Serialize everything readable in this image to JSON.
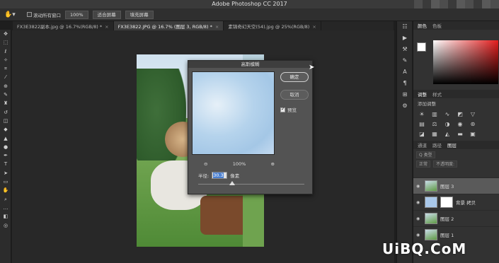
{
  "app": {
    "title": "Adobe Photoshop CC 2017"
  },
  "options": {
    "scroll_all_label": "滚动所有窗口",
    "zoom_100": "100%",
    "fit_screen": "适合屏幕",
    "fill_screen": "填充屏幕"
  },
  "tabs": [
    {
      "label": "FX3E3822副本.jpg @ 16.7%(RGB/8) *"
    },
    {
      "label": "FX3E3822.JPG @ 16.7% (图层 3, RGB/8) *"
    },
    {
      "label": "素锦奇幻天空(54).jpg @ 25%(RGB/8)"
    }
  ],
  "dialog": {
    "title": "高斯模糊",
    "ok_label": "确定",
    "cancel_label": "取消",
    "preview_label": "预览",
    "preview_checked": true,
    "zoom": "100%",
    "radius_label": "半径:",
    "radius_value": "30.3",
    "unit": "像素"
  },
  "panels": {
    "color_tabs": [
      "颜色",
      "色板"
    ],
    "adjust_tabs": [
      "调整",
      "样式"
    ],
    "adjust_add_label": "添加调整",
    "layer_tabs": [
      "通道",
      "路径",
      "图层"
    ],
    "kind_label": "Q 类型",
    "blend_mode": "正常",
    "opacity_label": "不透明度:"
  },
  "layers": [
    {
      "name": "图层 3",
      "selected": true,
      "thumb": "photo"
    },
    {
      "name": "背景 拷贝",
      "selected": false,
      "thumb": "sky"
    },
    {
      "name": "图层 2",
      "selected": false,
      "thumb": "photo"
    },
    {
      "name": "图层 1",
      "selected": false,
      "thumb": "photo"
    }
  ],
  "watermark": "UiBQ.CoM",
  "colors": {
    "accent_blue": "#4a7fd0",
    "panel_bg": "#323232",
    "dialog_bg": "#535353"
  }
}
